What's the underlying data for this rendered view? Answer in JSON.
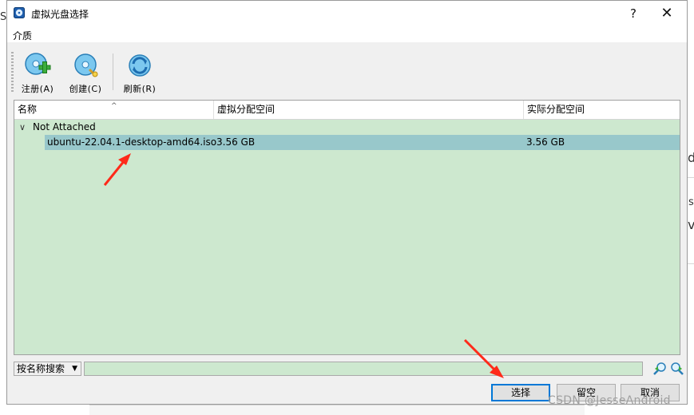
{
  "window": {
    "title": "虚拟光盘选择",
    "help": "?",
    "close": "✕"
  },
  "menu": {
    "medium": "介质"
  },
  "toolbar": {
    "register": "注册(A)",
    "create": "创建(C)",
    "refresh": "刷新(R)"
  },
  "table": {
    "columns": [
      "名称",
      "虚拟分配空间",
      "实际分配空间"
    ],
    "group_label": "Not Attached",
    "rows": [
      {
        "name": "ubuntu-22.04.1-desktop-amd64.iso",
        "virtual_size": "3.56 GB",
        "actual_size": "3.56 GB"
      }
    ]
  },
  "search": {
    "mode": "按名称搜索",
    "value": ""
  },
  "buttons": {
    "choose": "选择",
    "leave_empty": "留空",
    "cancel": "取消"
  },
  "background": {
    "frag1": "S",
    "frag2": "d",
    "frag3": "s",
    "frag4": "v"
  },
  "watermark": "CSDN @JesseAndroid",
  "colors": {
    "list_bg": "#cde8cf",
    "selected_row": "#98c8cb",
    "annotation_arrow": "#ff2a1a",
    "default_button_border": "#0078d7"
  }
}
